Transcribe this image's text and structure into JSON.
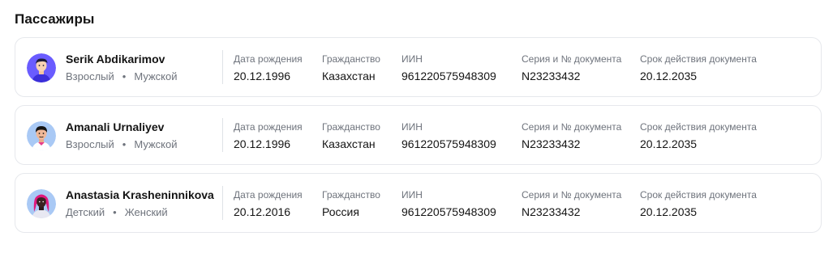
{
  "section_title": "Пассажиры",
  "labels": {
    "birth_date": "Дата рождения",
    "citizenship": "Гражданство",
    "iin": "ИИН",
    "doc_series": "Серия и № документа",
    "doc_expiry": "Срок действия документа"
  },
  "passengers": [
    {
      "name": "Serik Abdikarimov",
      "category": "Взрослый",
      "gender": "Мужской",
      "birth_date": "20.12.1996",
      "citizenship": "Казахстан",
      "iin": "961220575948309",
      "doc_number": "N23233432",
      "doc_expiry": "20.12.2035",
      "avatar_bg": "#6a5cff"
    },
    {
      "name": "Amanali Urnaliyev",
      "category": "Взрослый",
      "gender": "Мужской",
      "birth_date": "20.12.1996",
      "citizenship": "Казахстан",
      "iin": "961220575948309",
      "doc_number": "N23233432",
      "doc_expiry": "20.12.2035",
      "avatar_bg": "#a9c9f5"
    },
    {
      "name": "Anastasia Krasheninnikova",
      "category": "Детский",
      "gender": "Женский",
      "birth_date": "20.12.2016",
      "citizenship": "Россия",
      "iin": "961220575948309",
      "doc_number": "N23233432",
      "doc_expiry": "20.12.2035",
      "avatar_bg": "#a9c9f5"
    }
  ]
}
